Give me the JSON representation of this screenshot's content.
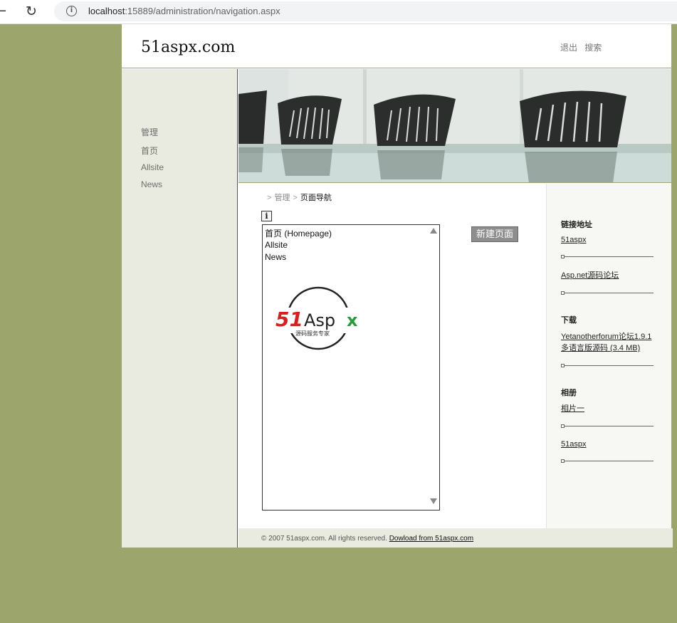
{
  "browser": {
    "url_host": "localhost",
    "url_path": ":15889/administration/navigation.aspx"
  },
  "site": {
    "logo": "51aspx.com",
    "top_links": [
      "退出",
      "搜索"
    ]
  },
  "sidebar": {
    "items": [
      {
        "label": "管理"
      },
      {
        "label": "首页"
      },
      {
        "label": "Allsite"
      },
      {
        "label": "News"
      }
    ]
  },
  "breadcrumb": {
    "sep": ">",
    "parent": "管理",
    "current": "页面导航"
  },
  "content": {
    "info_btn": "i",
    "list_items": [
      "首页 (Homepage)",
      "Allsite",
      "News"
    ],
    "brand_mark_text": "51Aspx",
    "brand_mark_sub": "源码服务专家",
    "new_page_btn": "新建页面"
  },
  "right_col": {
    "sections": [
      {
        "heading": "链接地址",
        "links": [
          "51aspx",
          "Asp.net源码论坛"
        ]
      },
      {
        "heading": "下载",
        "links": [
          "Yetanotherforum论坛1.9.1多语言版源码 (3.4 MB)"
        ]
      },
      {
        "heading": "相册",
        "links": [
          "相片一",
          "51aspx"
        ]
      }
    ],
    "download_line1": "Yetanotherforum论坛1.9.1",
    "download_line2": "多语言版源码 (3.4 MB)"
  },
  "footer": {
    "text": "© 2007 51aspx.com. All rights reserved.",
    "link": "Dowload from 51aspx.com"
  }
}
